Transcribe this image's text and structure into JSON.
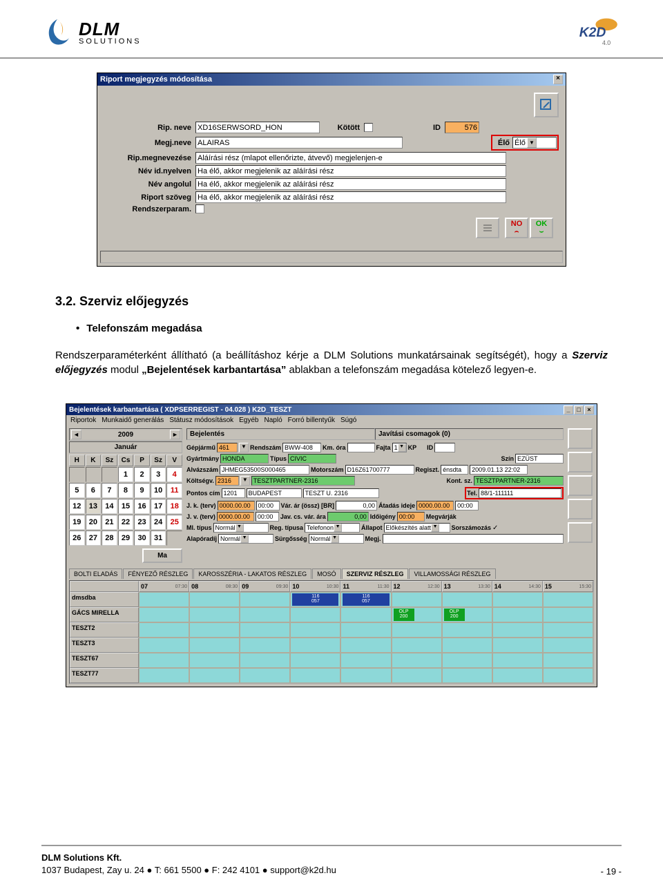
{
  "header": {
    "logo_main": "DLM",
    "logo_sub": "SOLUTIONS",
    "k2d_label": "K2D",
    "k2d_ver": "4.0"
  },
  "section": {
    "number": "3.2.",
    "title": "Szerviz előjegyzés",
    "bullet": "Telefonszám megadása",
    "para_pre": "Rendszerparaméterként állítható (a beállításhoz kérje a DLM Solutions munkatársainak segítségét), hogy a ",
    "para_em": "Szerviz előjegyzés",
    "para_mid": " modul ",
    "para_strong": "„Bejelentések karbantartása”",
    "para_post": " ablakban a telefonszám megadása kötelező legyen-e."
  },
  "dialog1": {
    "title": "Riport megjegyzés módosítása",
    "labels": {
      "rip_neve": "Rip. neve",
      "kotott": "Kötött",
      "id": "ID",
      "megj_neve": "Megj.neve",
      "elo_lbl": "Élő",
      "rip_megnev": "Rip.megnevezése",
      "nev_id": "Név id.nyelven",
      "nev_ang": "Név angolul",
      "rip_szov": "Riport szöveg",
      "rendszer": "Rendszerparam."
    },
    "values": {
      "rip_neve": "XD16SERWSORD_HON",
      "id": "576",
      "megj_neve": "ALAIRAS",
      "elo_sel": "Élő",
      "rip_megnev": "Aláírási rész (mlapot ellenőrizte, átvevő) megjelenjen-e",
      "nev_id": "Ha élő, akkor megjelenik az aláírási rész",
      "nev_ang": "Ha élő, akkor megjelenik az aláírási rész",
      "rip_szov": "Ha élő, akkor megjelenik az aláírási rész"
    },
    "btn_no": "NO",
    "btn_ok": "OK"
  },
  "dialog2": {
    "title": "Bejelentések karbantartása ( XDPSERREGIST - 04.028 )     K2D_TESZT",
    "menu": [
      "Riportok",
      "Munkaidő generálás",
      "Státusz módosítások",
      "Egyéb",
      "Napló",
      "Forró billentyűk",
      "Súgó"
    ],
    "calendar": {
      "year": "2009",
      "month": "Január",
      "dow": [
        "H",
        "K",
        "Sz",
        "Cs",
        "P",
        "Sz",
        "V"
      ],
      "days": [
        [
          "",
          "",
          "",
          "1",
          "2",
          "3",
          "4"
        ],
        [
          "5",
          "6",
          "7",
          "8",
          "9",
          "10",
          "11"
        ],
        [
          "12",
          "13",
          "14",
          "15",
          "16",
          "17",
          "18"
        ],
        [
          "19",
          "20",
          "21",
          "22",
          "23",
          "24",
          "25"
        ],
        [
          "26",
          "27",
          "28",
          "29",
          "30",
          "31",
          ""
        ]
      ],
      "today": "13",
      "ma_btn": "Ma"
    },
    "form": {
      "bejelentes": "Bejelentés",
      "javitasi": "Javítási csomagok (0)",
      "labels": {
        "gepjarmu": "Gépjármű",
        "rendszam": "Rendszám",
        "km_ora": "Km. óra",
        "fajta": "Fajta",
        "kp": "KP",
        "id": "ID",
        "gyartmany": "Gyártmány",
        "tipus": "Típus",
        "szin": "Szín",
        "alvazszam": "Alvázszám",
        "motorszam": "Motorszám",
        "regiszt": "Regiszt.",
        "koltsegv": "Költségv.",
        "kont_sz": "Kont. sz.",
        "pontos_cim": "Pontos cím",
        "tel": "Tel.",
        "jk_terv": "J. k. (terv)",
        "var_ar": "Vár. ár (össz) [BR]",
        "atadas": "Átadás ideje",
        "jv_terv": "J. v. (terv)",
        "jav_cs": "Jav. cs. vár. ára",
        "idoigeny": "Időigény",
        "megvarjak": "Megvárják",
        "ml_tipus": "Ml. típus",
        "reg_tipusa": "Reg. típusa",
        "allapot": "Állapot",
        "sorszamozas": "Sorszámozás",
        "alapordij": "Alapóradíj",
        "surgosseg": "Sürgősség",
        "megj": "Megj."
      },
      "values": {
        "gepjarmu": "461",
        "rendszam": "BWW-408",
        "km_ora": "",
        "fajta": "1",
        "id": "",
        "gyartmany": "HONDA",
        "tipus": "CIVIC",
        "szin": "EZÜST",
        "alvazszam": "JHMEG53500S000465",
        "motorszam": "D16Z61700777",
        "regiszt_t": "énsdta",
        "regiszt_d": "2009.01.13 22:02",
        "koltsegv": "2316",
        "koltsegv_nev": "TESZTPARTNER-2316",
        "kont_sz": "TESZTPARTNER-2316",
        "pontos_cim_zip": "1201",
        "pontos_cim_city": "BUDAPEST",
        "pontos_cim_addr": "TESZT U. 2316",
        "tel": "88/1-111111",
        "jk_terv_t": "0000.00.00",
        "jk_terv_h": "00:00",
        "var_ar": "0,00",
        "atadas_t": "0000.00.00",
        "atadas_h": "00:00",
        "jv_terv_t": "0000.00.00",
        "jv_terv_h": "00:00",
        "jav_cs": "0,00",
        "idoigeny": "00:00",
        "ml_tipus": "Normál",
        "reg_tipusa": "Telefonon",
        "allapot": "Előkészítés alatt",
        "alapordij": "Normál",
        "surgosseg": "Normál",
        "megj": ""
      }
    },
    "tabs": [
      "BOLTI ELADÁS",
      "FÉNYEZŐ RÉSZLEG",
      "KAROSSZÉRIA - LAKATOS RÉSZLEG",
      "MOSÓ",
      "SZERVIZ RÉSZLEG",
      "VILLAMOSSÁGI RÉSZLEG"
    ],
    "active_tab": 4,
    "gantt": {
      "hours": [
        "07",
        "08",
        "09",
        "10",
        "11",
        "12",
        "13",
        "14",
        "15"
      ],
      "subs": [
        "07:30",
        "08:30",
        "09:30",
        "10:30",
        "11:30",
        "12:30",
        "13:30",
        "14:30",
        "15:30"
      ],
      "rows": [
        "dmsdba",
        "GÁCS MIRELLA",
        "TESZT2",
        "TESZT3",
        "TESZT67",
        "TESZT77"
      ],
      "blocks": [
        {
          "row": 0,
          "text1": "116",
          "text2": "057"
        },
        {
          "row": 1,
          "text1": "OLP",
          "text2": "200"
        }
      ]
    }
  },
  "footer": {
    "company": "DLM Solutions Kft.",
    "addr": "1037 Budapest, Zay u. 24",
    "tel": "T: 661 5500",
    "fax": "F: 242 4101",
    "email": "support@k2d.hu",
    "page": "- 19 -"
  }
}
